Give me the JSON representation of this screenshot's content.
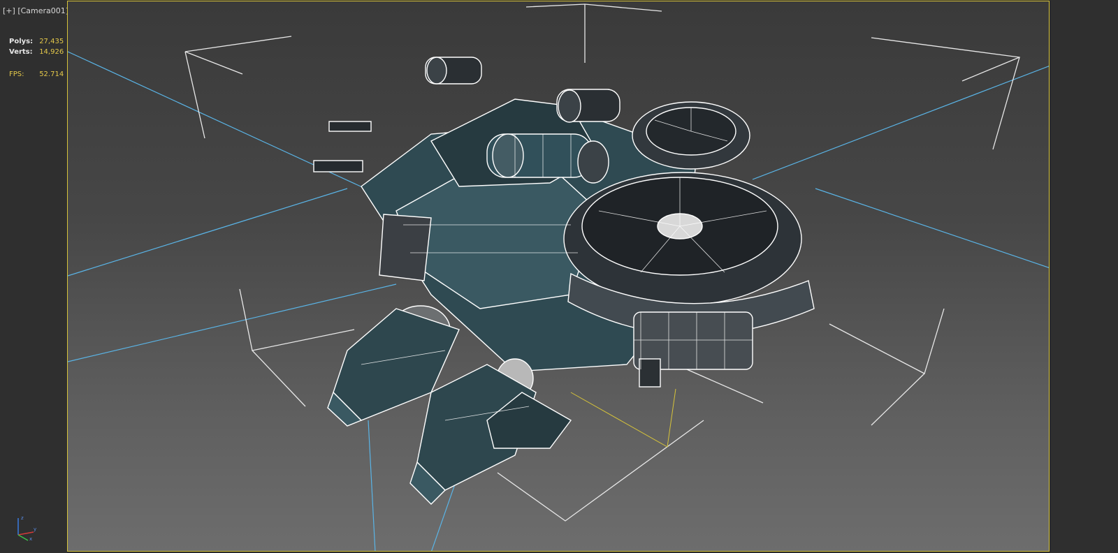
{
  "viewport": {
    "menu_plus": "[+]",
    "camera_name": "[Camera001]"
  },
  "stats": {
    "polys_label": "Polys:",
    "polys_value": "27,435",
    "verts_label": "Verts:",
    "verts_value": "14,926",
    "fps_label": "FPS:",
    "fps_value": "52.714"
  },
  "colors": {
    "viewport_border": "#d6c33a",
    "stat_value": "#e5c94a",
    "camera_line": "#5ab4e6",
    "wire": "#ffffff",
    "mech_fill": "#2f4a52"
  },
  "icons": {
    "axis_gizmo": "xyz-axis-icon"
  }
}
